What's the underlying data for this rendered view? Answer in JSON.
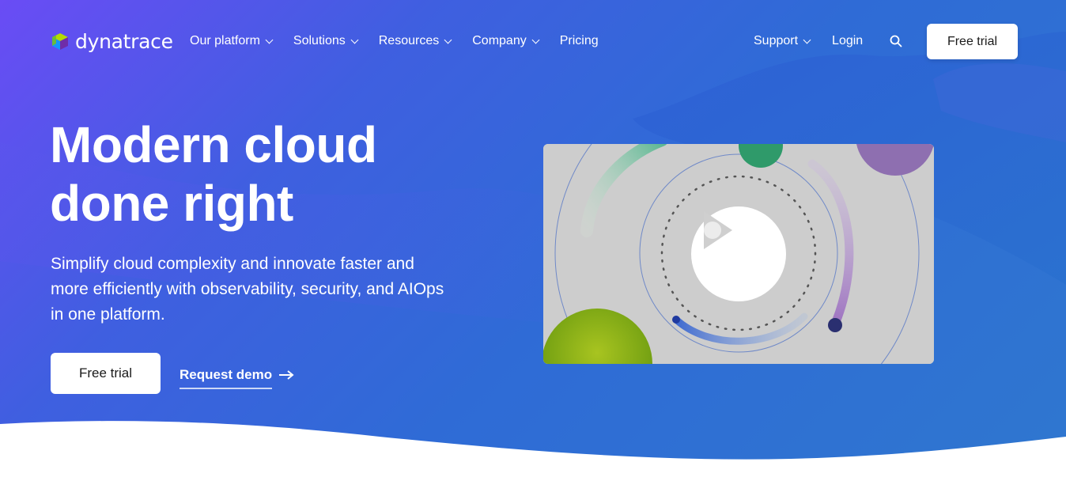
{
  "brand": {
    "name": "dynatrace",
    "colors": {
      "gradient_start": "#6a4cf5",
      "gradient_mid": "#3f5fe0",
      "gradient_end": "#2f77cf",
      "logo_green": "#8bc34a",
      "logo_purple": "#7b3ff2",
      "logo_blue": "#1496ff"
    }
  },
  "nav": {
    "left_items": [
      {
        "label": "Our platform",
        "has_dropdown": true
      },
      {
        "label": "Solutions",
        "has_dropdown": true
      },
      {
        "label": "Resources",
        "has_dropdown": true
      },
      {
        "label": "Company",
        "has_dropdown": true
      },
      {
        "label": "Pricing",
        "has_dropdown": false
      }
    ],
    "support_label": "Support",
    "login_label": "Login",
    "search_icon": "search-icon",
    "cta_label": "Free trial"
  },
  "hero": {
    "headline_line1": "Modern cloud",
    "headline_line2": "done right",
    "subhead": "Simplify cloud complexity and innovate faster and more efficiently with observability, security, and AIOps in one platform.",
    "primary_cta": "Free trial",
    "secondary_cta": "Request demo",
    "arrow_icon": "arrow-right-icon"
  },
  "video": {
    "play_icon": "play-icon"
  }
}
